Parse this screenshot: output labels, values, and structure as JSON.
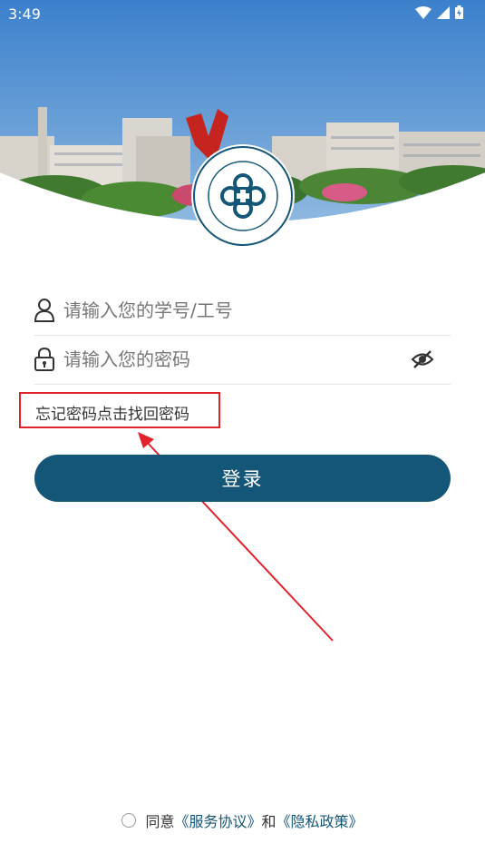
{
  "status": {
    "time": "3:49"
  },
  "login": {
    "id_placeholder": "请输入您的学号/工号",
    "password_placeholder": "请输入您的密码",
    "forgot_password": "忘记密码点击找回密码",
    "login_button": "登录"
  },
  "agreement": {
    "agree": "同意",
    "service_terms": "《服务协议》",
    "and": "和",
    "privacy_policy": "《隐私政策》"
  },
  "colors": {
    "primary": "#145677",
    "annotation": "#e3232c"
  }
}
